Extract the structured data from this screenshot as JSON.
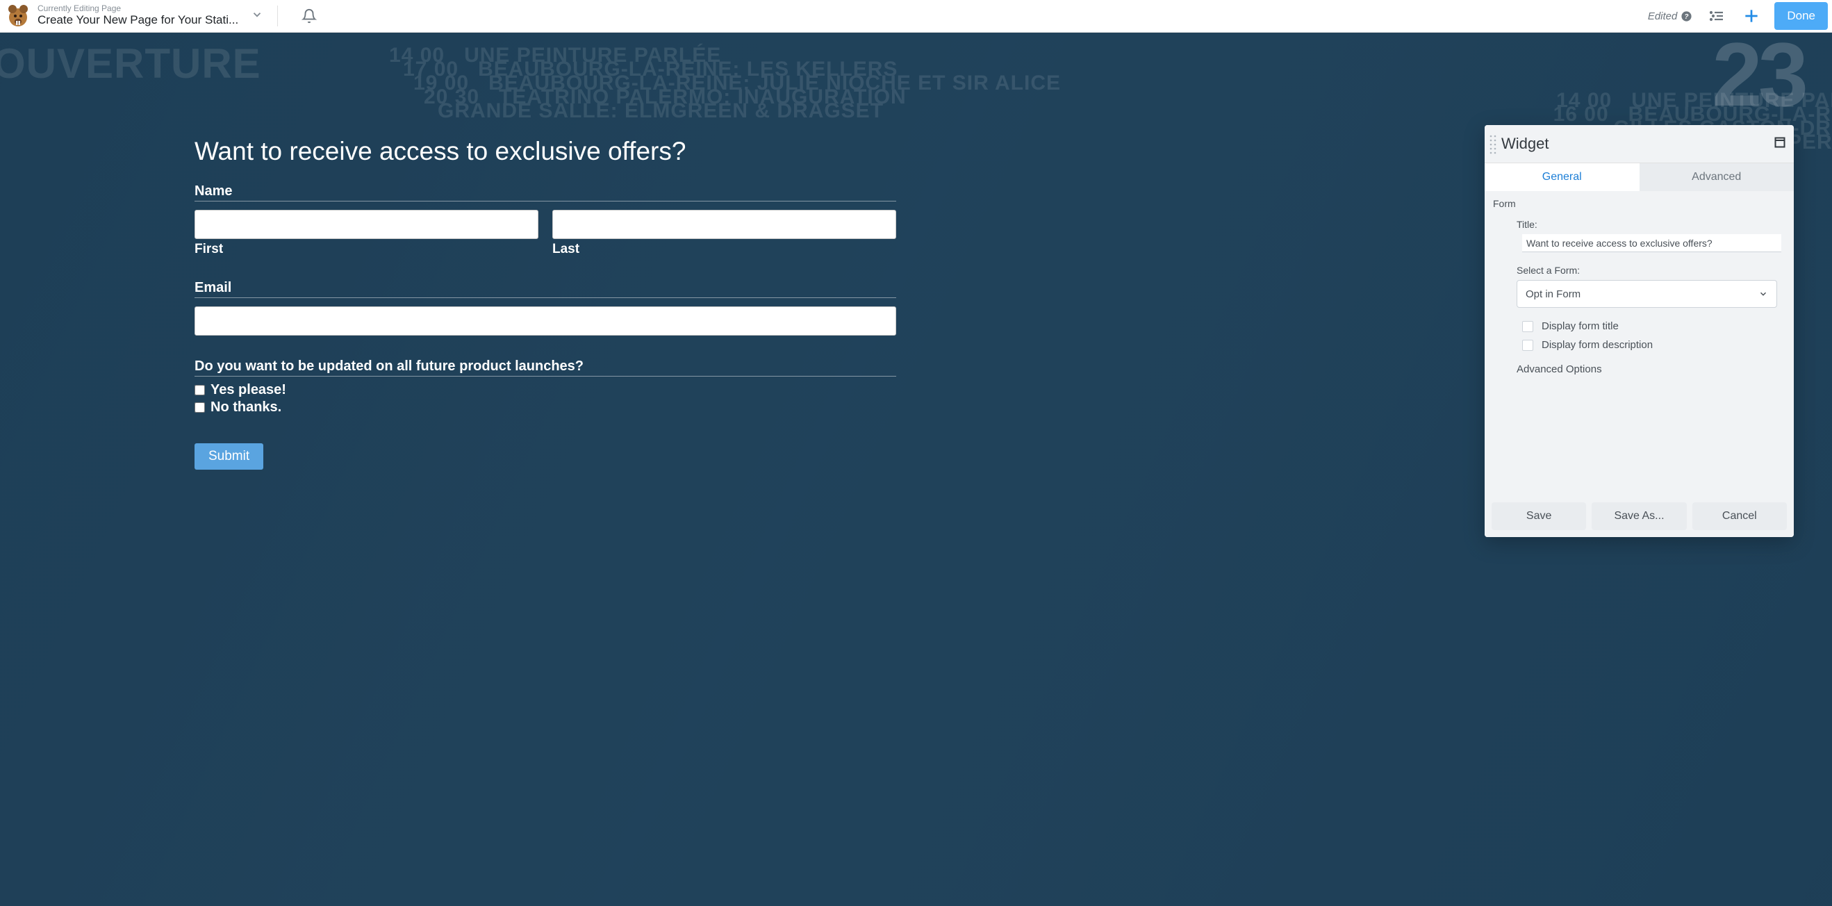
{
  "header": {
    "subtitle": "Currently Editing Page",
    "title": "Create Your New Page for Your Stati...",
    "edited_label": "Edited",
    "done_label": "Done"
  },
  "form": {
    "heading": "Want to receive access to exclusive offers?",
    "name_label": "Name",
    "first_label": "First",
    "last_label": "Last",
    "email_label": "Email",
    "question_label": "Do you want to be updated on all future product launches?",
    "option_yes": "Yes please!",
    "option_no": "No thanks.",
    "submit_label": "Submit"
  },
  "widget": {
    "panel_title": "Widget",
    "tabs": {
      "general": "General",
      "advanced": "Advanced"
    },
    "section_label": "Form",
    "title_label": "Title:",
    "title_value": "Want to receive access to exclusive offers?",
    "select_label": "Select a Form:",
    "select_value": "Opt in Form",
    "cb_display_title": "Display form title",
    "cb_display_desc": "Display form description",
    "advanced_options": "Advanced Options",
    "footer": {
      "save": "Save",
      "save_as": "Save As...",
      "cancel": "Cancel"
    }
  },
  "bg_decor": {
    "big_number": "23"
  }
}
